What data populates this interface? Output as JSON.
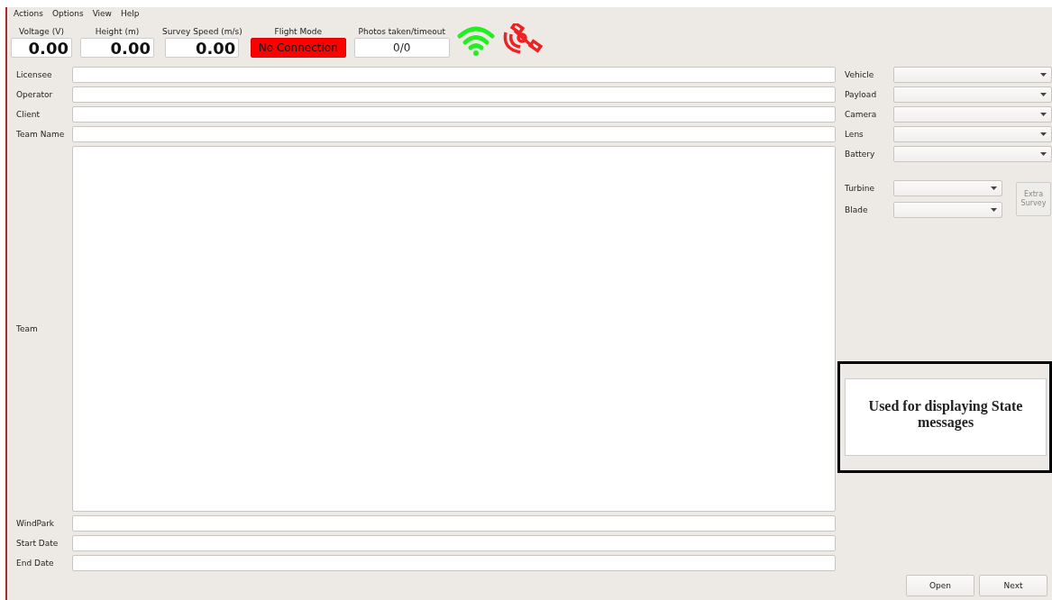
{
  "menu": [
    "Actions",
    "Options",
    "View",
    "Help"
  ],
  "indicators": [
    {
      "kind": "number",
      "label": "Voltage (V)",
      "value": "0.00"
    },
    {
      "kind": "number",
      "label": "Height (m)",
      "value": "0.00"
    },
    {
      "kind": "number",
      "label": "Survey Speed (m/s)",
      "value": "0.00"
    },
    {
      "kind": "status",
      "label": "Flight Mode",
      "value": "No Connection"
    },
    {
      "kind": "text",
      "label": "Photos taken/timeout",
      "value": "0/0"
    }
  ],
  "status_icons": {
    "wifi_connected": true,
    "gps_fix": false
  },
  "form": [
    {
      "kind": "line",
      "label": "Licensee"
    },
    {
      "kind": "line",
      "label": "Operator"
    },
    {
      "kind": "line",
      "label": "Client"
    },
    {
      "kind": "line",
      "label": "Team Name"
    },
    {
      "kind": "area",
      "label": "Team"
    },
    {
      "kind": "line",
      "label": "WindPark"
    },
    {
      "kind": "line",
      "label": "Start Date"
    },
    {
      "kind": "line",
      "label": "End Date"
    }
  ],
  "equipment": [
    "Vehicle",
    "Payload",
    "Camera",
    "Lens",
    "Battery"
  ],
  "target": [
    "Turbine",
    "Blade"
  ],
  "extra_survey": {
    "label": "Extra Survey",
    "disabled": true
  },
  "state_message": "Used for displaying State messages",
  "buttons": [
    "Open",
    "Next"
  ]
}
